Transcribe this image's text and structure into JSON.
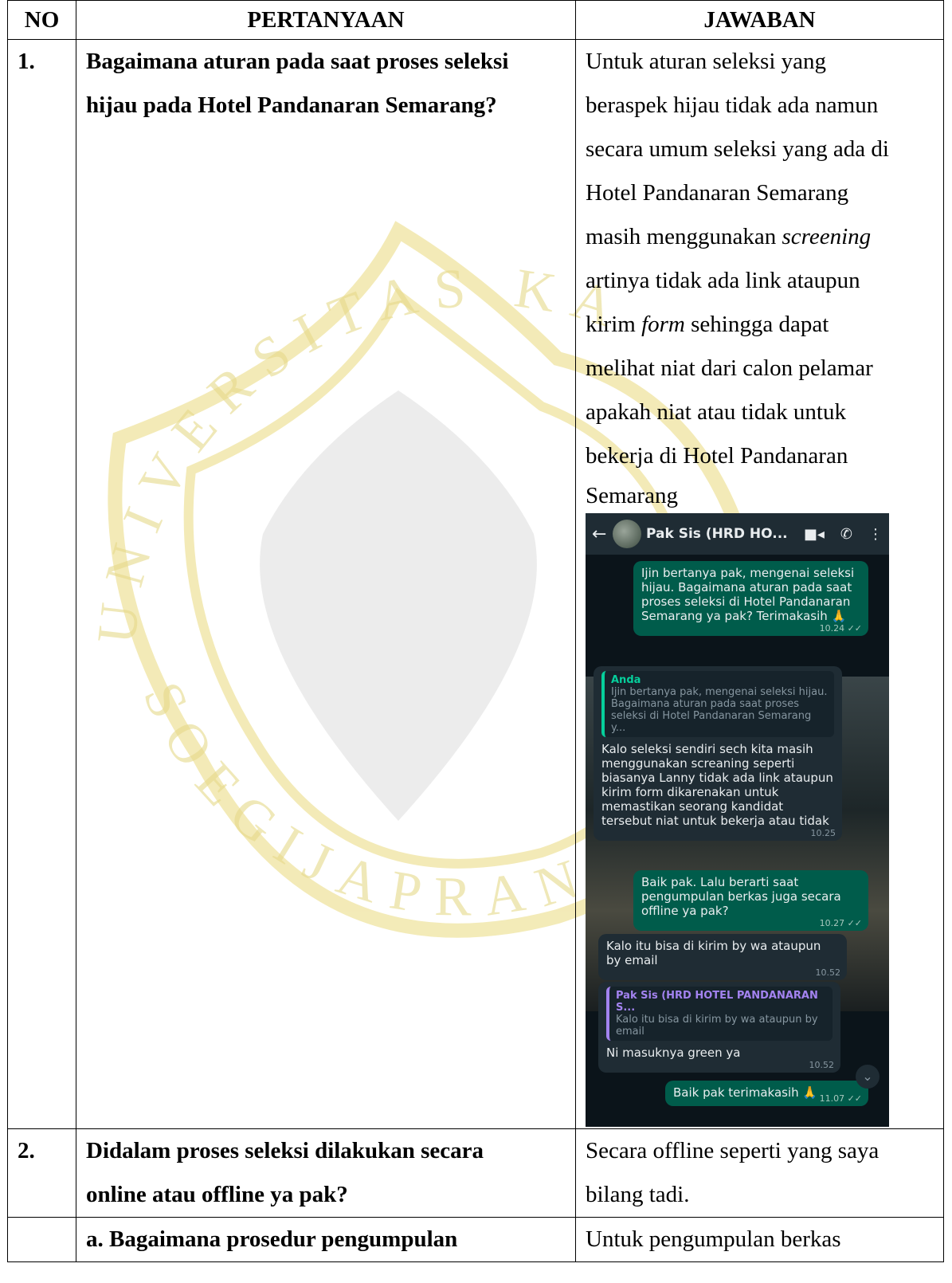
{
  "table": {
    "headers": [
      "NO",
      "PERTANYAAN",
      "JAWABAN"
    ],
    "rows": [
      {
        "no": "1.",
        "question_lines": [
          "Bagaimana aturan pada saat proses seleksi",
          "hijau pada Hotel Pandanaran Semarang?"
        ],
        "answer_lines": [
          "Untuk aturan seleksi yang",
          "beraspek hijau tidak ada namun",
          "secara umum seleksi yang ada di",
          "Hotel Pandanaran Semarang"
        ],
        "answer_l5_pre": "masih menggunakan ",
        "answer_l5_italic": "screening",
        "answer_l6": "artinya tidak ada link ataupun",
        "answer_l7_pre": "kirim ",
        "answer_l7_italic": "form",
        "answer_l7_post": " sehingga dapat",
        "answer_tail_lines": [
          "melihat niat dari calon pelamar",
          "apakah niat atau tidak untuk",
          "bekerja di Hotel Pandanaran",
          "Semarang"
        ]
      },
      {
        "no": "2.",
        "question_lines": [
          "Didalam proses seleksi dilakukan secara",
          "online atau offline ya pak?"
        ],
        "answer_lines": [
          "Secara offline seperti yang saya",
          "bilang tadi."
        ]
      },
      {
        "no": "",
        "question_sub": "a.  Bagaimana prosedur pengumpulan",
        "answer_lines": [
          "Untuk pengumpulan berkas"
        ]
      }
    ]
  },
  "chat": {
    "contact": "Pak Sis (HRD HO...",
    "messages": {
      "m1": {
        "text": "Ijin bertanya pak, mengenai seleksi hijau. Bagaimana aturan pada saat proses seleksi di Hotel Pandanaran Semarang ya pak? Terimakasih 🙏",
        "time": "10.24 ✓✓"
      },
      "m2": {
        "quote_name": "Anda",
        "quote_text": "Ijin bertanya pak, mengenai seleksi hijau. Bagaimana aturan pada saat proses seleksi di Hotel Pandanaran Semarang y...",
        "text": "Kalo seleksi sendiri sech kita masih menggunakan screaning seperti biasanya Lanny tidak ada link ataupun kirim form dikarenakan untuk memastikan seorang kandidat tersebut niat untuk bekerja atau tidak",
        "time": "10.25"
      },
      "m3": {
        "text": "Baik pak. Lalu berarti saat pengumpulan berkas juga secara offline ya pak?",
        "time": "10.27 ✓✓"
      },
      "m4": {
        "text": "Kalo itu bisa di kirim by wa ataupun by email",
        "time": "10.52"
      },
      "m5": {
        "quote_name": "Pak Sis (HRD HOTEL PANDANARAN S...",
        "quote_text": "Kalo itu bisa di kirim by wa ataupun by email",
        "text": "Ni masuknya green ya",
        "time": "10.52"
      },
      "m6": {
        "text": "Baik pak terimakasih 🙏",
        "time": "11.07 ✓✓"
      }
    }
  },
  "watermark": {
    "top_text": "UNIVERSITAS KATOLIK",
    "bottom_text": "SOEGIJAPRANATA"
  },
  "colors": {
    "watermark": "#efe4a0",
    "chat_bg": "#0b141a",
    "out_bubble": "#005c4b",
    "in_bubble": "#1f2c34"
  }
}
